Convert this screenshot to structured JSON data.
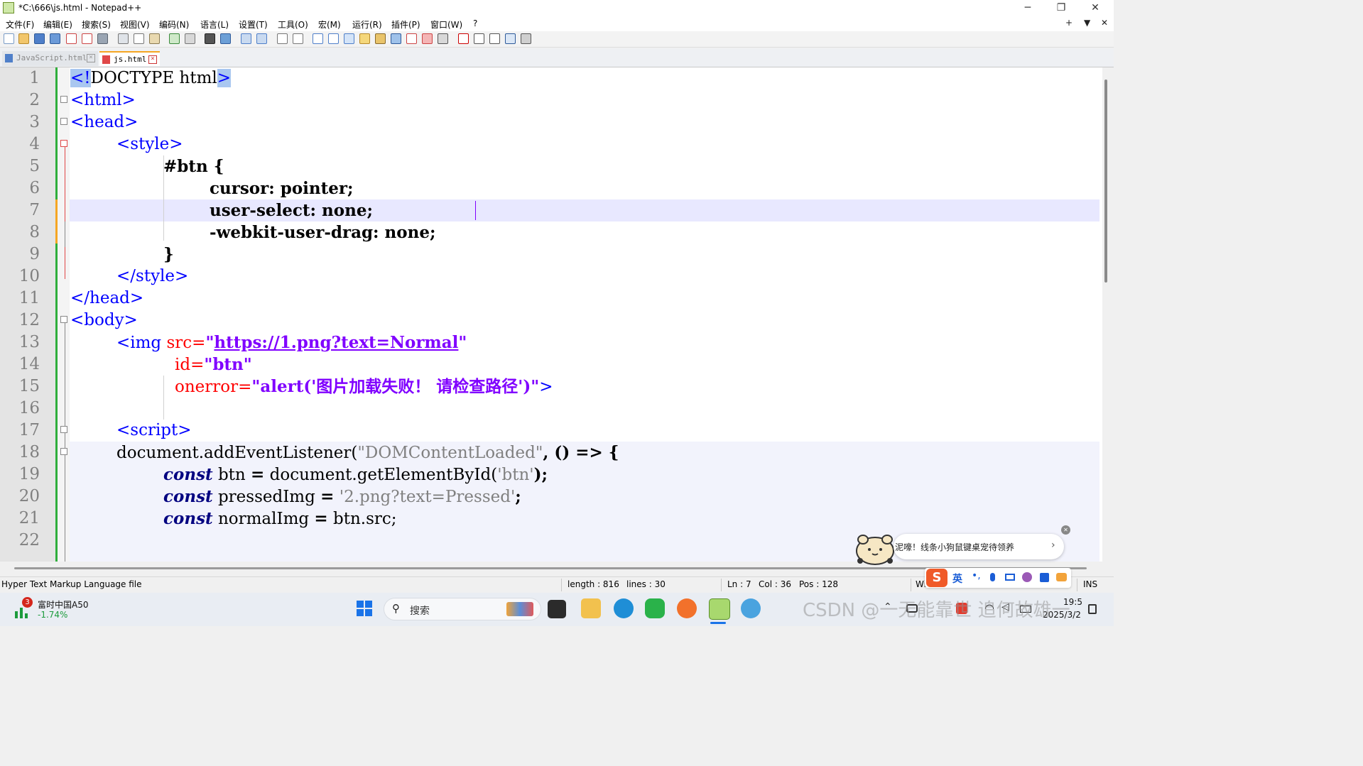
{
  "window": {
    "title": "*C:\\666\\js.html - Notepad++",
    "minimize_glyph": "─",
    "restore_glyph": "❐",
    "close_glyph": "✕"
  },
  "menu": {
    "items": [
      "文件(F)",
      "编辑(E)",
      "搜索(S)",
      "视图(V)",
      "编码(N)",
      "语言(L)",
      "设置(T)",
      "工具(O)",
      "宏(M)",
      "运行(R)",
      "插件(P)",
      "窗口(W)",
      "?"
    ],
    "right_plus": "+",
    "right_down": "▼",
    "right_close": "✕"
  },
  "tabs": [
    {
      "label": "JavaScript.html",
      "active": false
    },
    {
      "label": "js.html",
      "active": true
    }
  ],
  "editor": {
    "line_numbers": [
      "1",
      "2",
      "3",
      "4",
      "5",
      "6",
      "7",
      "8",
      "9",
      "10",
      "11",
      "12",
      "13",
      "14",
      "15",
      "16",
      "17",
      "18",
      "19",
      "20",
      "21",
      "22"
    ],
    "line1": {
      "open": "<!",
      "doctype": "DOCTYPE html",
      "close": ">"
    },
    "line2": "<html>",
    "line3": "<head>",
    "line4": "<style>",
    "line5": "#btn {",
    "line6": "cursor: pointer;",
    "line7": "user-select: none;",
    "line8": "-webkit-user-drag: none;",
    "line9": "}",
    "line10": "</style>",
    "line11": "</head>",
    "line12": "<body>",
    "line13": {
      "tag": "<img",
      "attr": "src=",
      "q1": "\"",
      "url": "https://1.png?text=Normal",
      "q2": "\""
    },
    "line14": {
      "attr": "id=",
      "val": "\"btn\""
    },
    "line15": {
      "attr": "onerror=",
      "val": "\"alert('图片加载失败！ 请检查路径')\"",
      "close": ">"
    },
    "line17": "<script>",
    "line18": {
      "obj": "document.addEventListener(",
      "str": "\"DOMContentLoaded\"",
      "rest": ", () => {"
    },
    "line19": {
      "kw": "const",
      "a": " btn ",
      "op": "=",
      "b": " document.getElementById(",
      "str": "'btn'",
      "c": ");"
    },
    "line20": {
      "kw": "const",
      "a": " pressedImg ",
      "op": "=",
      "str": " '2.png?text=Pressed'",
      "c": ";"
    },
    "line21": {
      "kw": "const",
      "a": " normalImg ",
      "op": "=",
      "b": " btn.src;"
    }
  },
  "status": {
    "file_type": "Hyper Text Markup Language file",
    "length": "length : 816",
    "lines": "lines : 30",
    "ln": "Ln : 7",
    "col": "Col : 36",
    "pos": "Pos : 128",
    "eol": "Wi",
    "mode": "INS"
  },
  "popup": {
    "text": "泥嚎！线条小狗鼠键桌宠待领养",
    "arrow": "›",
    "close": "✕"
  },
  "ime": {
    "lang": "英",
    "punct": "•,"
  },
  "taskbar": {
    "stock_badge": "3",
    "stock_name": "富时中国A50",
    "stock_change": "-1.74%",
    "search_placeholder": "搜索",
    "time": "19:5",
    "date": "2025/3/2",
    "watermark": "CSDN @一无能靠世 追何故雄一"
  },
  "colors": {
    "tag": "#0000ff",
    "attribute": "#ff0000",
    "string": "#8000ff",
    "keyword": "#000080",
    "current_line": "#e8e8ff",
    "change_marker": "#2fae3c"
  }
}
